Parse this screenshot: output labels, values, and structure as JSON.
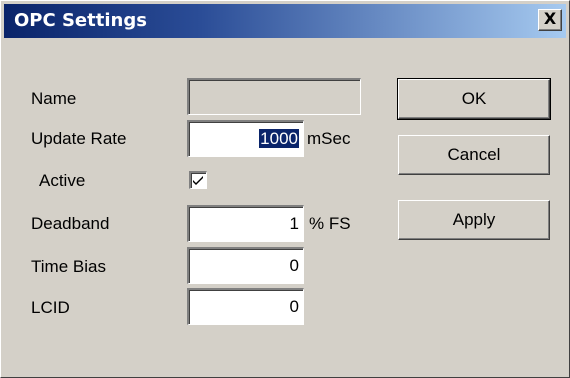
{
  "window": {
    "title": "OPC Settings",
    "close_glyph": "X"
  },
  "fields": {
    "name": {
      "label": "Name",
      "value": ""
    },
    "update_rate": {
      "label": "Update Rate",
      "value": "1000",
      "unit": "mSec"
    },
    "active": {
      "label": "Active",
      "checked": true
    },
    "deadband": {
      "label": "Deadband",
      "value": "1",
      "unit": "% FS"
    },
    "time_bias": {
      "label": "Time Bias",
      "value": "0"
    },
    "lcid": {
      "label": "LCID",
      "value": "0"
    }
  },
  "buttons": {
    "ok": "OK",
    "cancel": "Cancel",
    "apply": "Apply"
  },
  "colors": {
    "dialog_face": "#d4d0c8",
    "titlebar_start": "#0a246a",
    "titlebar_end": "#a6caf0",
    "selection": "#0a246a"
  },
  "icons": {
    "close": "close-icon",
    "check": "checkmark-icon"
  }
}
